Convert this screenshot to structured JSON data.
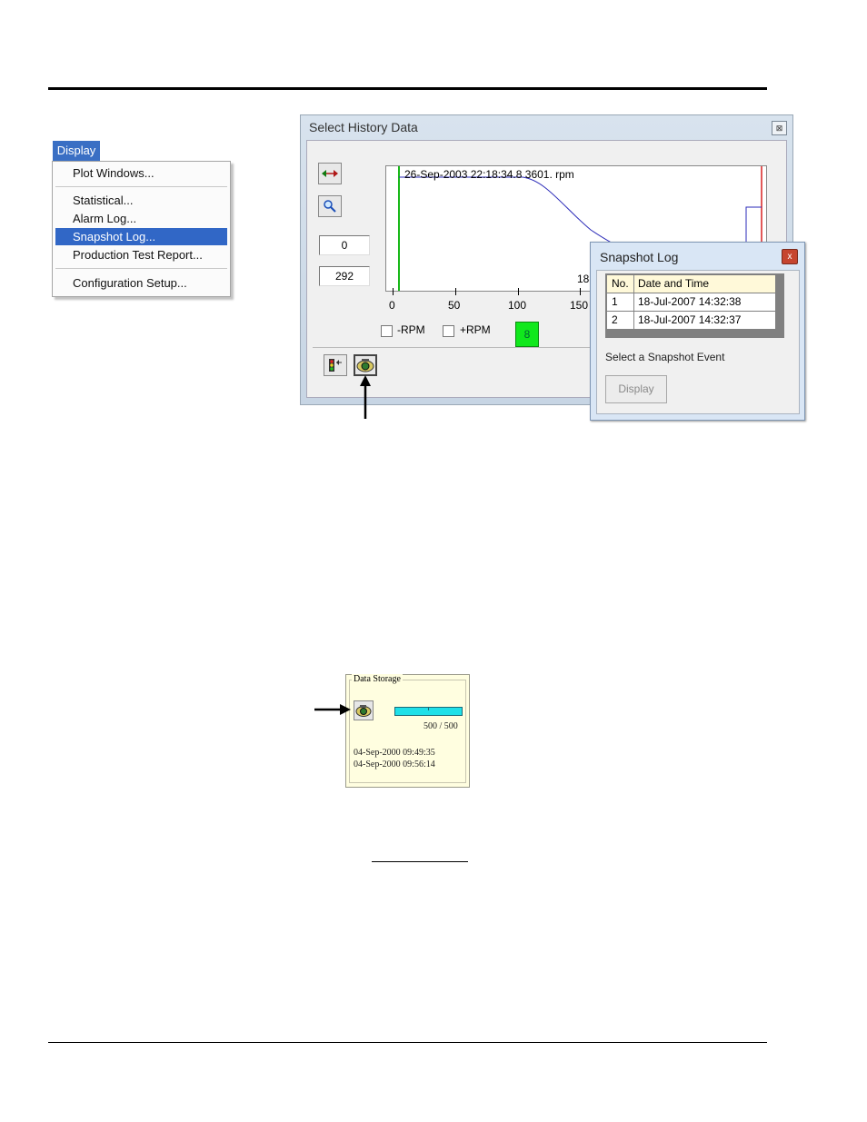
{
  "menu": {
    "header": "Display",
    "items": [
      {
        "label": "Plot Windows..."
      },
      {
        "label": "Statistical..."
      },
      {
        "label": "Alarm Log..."
      },
      {
        "label": "Snapshot Log..."
      },
      {
        "label": "Production Test Report..."
      },
      {
        "label": "Configuration Setup..."
      }
    ],
    "selected": "Snapshot Log..."
  },
  "history_window": {
    "title": "Select History Data",
    "close_glyph": "⊠",
    "start_value": "0",
    "end_value": "292",
    "plot_header": "26-Sep-2003 22:18:34.8  3601.  rpm",
    "plot_partial_label": "18-",
    "x_ticks": [
      "0",
      "50",
      "100",
      "150"
    ],
    "minus_rpm_label": "-RPM",
    "plus_rpm_label": "+RPM",
    "indicator_value": "8"
  },
  "snapshot_log": {
    "title": "Snapshot Log",
    "close_glyph": "x",
    "columns": [
      "No.",
      "Date and Time"
    ],
    "rows": [
      {
        "no": "1",
        "datetime": "18-Jul-2007 14:32:38"
      },
      {
        "no": "2",
        "datetime": "18-Jul-2007 14:32:37"
      }
    ],
    "caption": "Select a Snapshot Event",
    "display_button": "Display"
  },
  "data_storage": {
    "title": "Data Storage",
    "count": "500 / 500",
    "fill_fraction": 1.0,
    "start_time": "04-Sep-2000 09:49:35",
    "end_time": "04-Sep-2000 09:56:14"
  },
  "colors": {
    "menu_highlight": "#3167c6",
    "window_frame": "#d0dcea",
    "indicator_green": "#10e81c",
    "storage_bar": "#1fe0e8",
    "panel_yellow": "#fffee0"
  }
}
